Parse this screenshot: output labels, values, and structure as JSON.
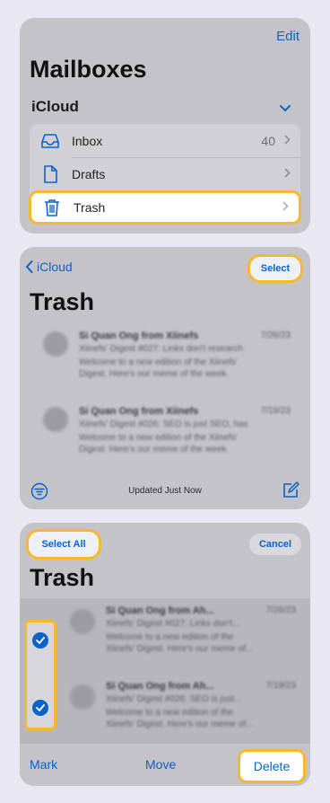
{
  "mailboxes": {
    "edit_label": "Edit",
    "title": "Mailboxes",
    "account": "iCloud",
    "items": [
      {
        "label": "Inbox",
        "count": "40",
        "icon": "inbox-icon"
      },
      {
        "label": "Drafts",
        "count": "",
        "icon": "document-icon"
      },
      {
        "label": "Trash",
        "count": "",
        "icon": "trash-icon"
      }
    ]
  },
  "trash_view": {
    "back_label": "iCloud",
    "select_label": "Select",
    "title": "Trash",
    "status": "Updated Just Now",
    "messages": [
      {
        "sender": "Si Quan Ong from Xiinefs",
        "date": "7/26/23",
        "subject": "Xiinefs' Digest #027: Links don't research",
        "preview": "Welcome to a new edition of the Xiinefs' Digest. Here's our meme of the week."
      },
      {
        "sender": "Si Quan Ong from Xiinefs",
        "date": "7/19/23",
        "subject": "Xiinefs' Digest #026: SEO is just SEO, has",
        "preview": "Welcome to a new edition of the Xiinefs' Digest. Here's our meme of the week."
      }
    ]
  },
  "select_view": {
    "select_all_label": "Select All",
    "cancel_label": "Cancel",
    "title": "Trash",
    "messages": [
      {
        "sender": "Si Quan Ong from Ah...",
        "date": "7/26/23",
        "subject": "Xiinefs' Digest #027: Links don't...",
        "preview": "Welcome to a new edition of the Xiinefs' Digest. Here's our meme of..."
      },
      {
        "sender": "Si Quan Ong from Ah...",
        "date": "7/19/23",
        "subject": "Xiinefs' Digest #026: SEO is just...",
        "preview": "Welcome to a new edition of the Xiinefs' Digest. Here's our meme of..."
      }
    ],
    "mark_label": "Mark",
    "move_label": "Move",
    "delete_label": "Delete"
  },
  "colors": {
    "accent": "#0a63c9",
    "highlight": "#f2ba2c",
    "panel": "#c4c3c8",
    "background": "#e9e7f1"
  }
}
